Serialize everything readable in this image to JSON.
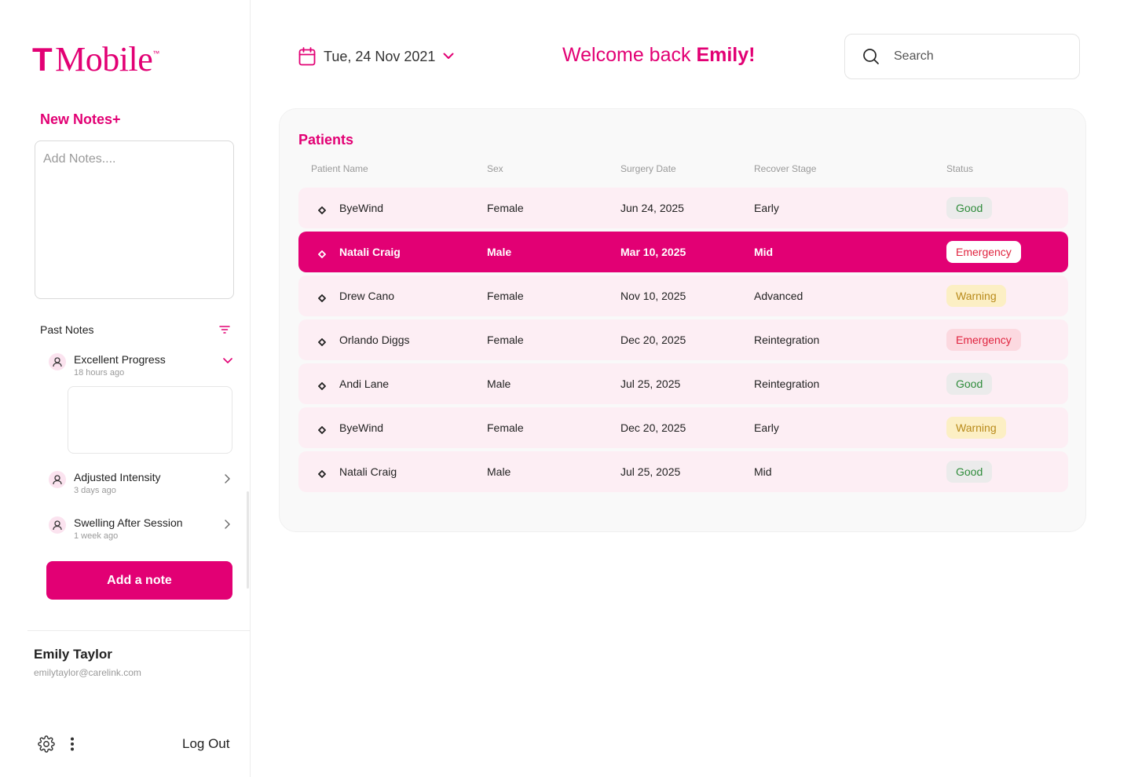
{
  "brand": {
    "name": "Mobile",
    "mark": "T",
    "trademark": "™",
    "accent": "#e20074"
  },
  "sidebar": {
    "new_notes_label": "New Notes+",
    "notes_placeholder": "Add Notes....",
    "past_notes_title": "Past Notes",
    "past_notes": [
      {
        "title": "Excellent Progress",
        "time": "18 hours ago"
      },
      {
        "title": "Adjusted Intensity",
        "time": "3 days ago"
      },
      {
        "title": "Swelling After Session",
        "time": "1 week ago"
      }
    ],
    "add_note_label": "Add a note",
    "user": {
      "name": "Emily Taylor",
      "email": "emilytaylor@carelink.com"
    },
    "logout_label": "Log Out"
  },
  "header": {
    "date": "Tue, 24 Nov 2021",
    "welcome_prefix": "Welcome back ",
    "welcome_name": "Emily!",
    "search_placeholder": "Search"
  },
  "patients": {
    "title": "Patients",
    "columns": [
      "Patient Name",
      "Sex",
      "Surgery Date",
      "Recover Stage",
      "Status"
    ],
    "rows": [
      {
        "name": "ByeWind",
        "sex": "Female",
        "date": "Jun 24, 2025",
        "stage": "Early",
        "status": "Good"
      },
      {
        "name": "Natali Craig",
        "sex": "Male",
        "date": "Mar 10, 2025",
        "stage": "Mid",
        "status": "Emergency"
      },
      {
        "name": "Drew Cano",
        "sex": "Female",
        "date": "Nov 10, 2025",
        "stage": "Advanced",
        "status": "Warning"
      },
      {
        "name": "Orlando Diggs",
        "sex": "Female",
        "date": "Dec 20, 2025",
        "stage": "Reintegration",
        "status": "Emergency"
      },
      {
        "name": "Andi Lane",
        "sex": "Male",
        "date": "Jul 25, 2025",
        "stage": "Reintegration",
        "status": "Good"
      },
      {
        "name": "ByeWind",
        "sex": "Female",
        "date": "Dec 20, 2025",
        "stage": "Early",
        "status": "Warning"
      },
      {
        "name": "Natali Craig",
        "sex": "Male",
        "date": "Jul 25, 2025",
        "stage": "Mid",
        "status": "Good"
      }
    ]
  },
  "colors": {
    "good": "#2e8b3a",
    "warning": "#b88a1a",
    "emergency": "#e0243f",
    "row_bg": "#fdeef4"
  }
}
